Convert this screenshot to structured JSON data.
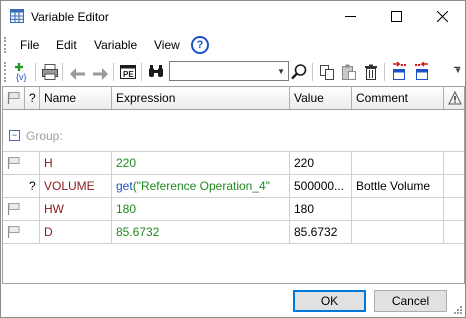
{
  "window": {
    "title": "Variable Editor",
    "icons": {
      "app": "table-icon",
      "minimize": "minimize-icon",
      "maximize": "maximize-icon",
      "close": "close-icon"
    }
  },
  "menu": {
    "items": [
      "File",
      "Edit",
      "Variable",
      "View"
    ],
    "help_icon": "?"
  },
  "toolbar": {
    "icons": [
      "add-variable-icon",
      "print-icon",
      "undo-icon",
      "redo-icon",
      "properties-icon",
      "find-icon",
      "search-go-icon",
      "copy-icon",
      "paste-icon",
      "delete-icon",
      "import-icon",
      "export-icon"
    ],
    "search": {
      "value": "",
      "placeholder": ""
    }
  },
  "grid": {
    "columns": {
      "flag": "",
      "unknown": "?",
      "name": "Name",
      "expression": "Expression",
      "value": "Value",
      "comment": "Comment",
      "warning": "warning-icon"
    },
    "group": {
      "toggle": "−",
      "label": "Group:"
    },
    "rows": [
      {
        "mark": "",
        "name": "H",
        "expression": "220",
        "value": "220",
        "comment": ""
      },
      {
        "mark": "?",
        "name": "VOLUME",
        "expression_fn": "get",
        "expression": "(\"Reference Operation_4\"",
        "value": "500000...",
        "comment": "Bottle Volume"
      },
      {
        "mark": "",
        "name": "HW",
        "expression": "180",
        "value": "180",
        "comment": ""
      },
      {
        "mark": "",
        "name": "D",
        "expression": "85.6732",
        "value": "85.6732",
        "comment": ""
      }
    ]
  },
  "buttons": {
    "ok": "OK",
    "cancel": "Cancel"
  },
  "colors": {
    "name": "#8b1a1a",
    "expression": "#1f8a1f",
    "function": "#1e50c8",
    "group": "#a0a0a0"
  }
}
